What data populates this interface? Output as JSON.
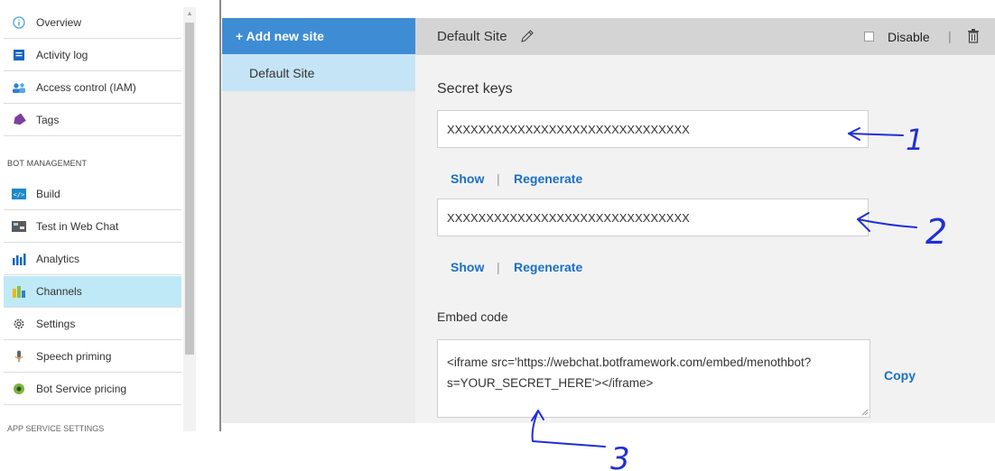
{
  "nav": {
    "items_top": [
      {
        "label": "Overview",
        "icon": "info-icon"
      },
      {
        "label": "Activity log",
        "icon": "log-icon"
      },
      {
        "label": "Access control (IAM)",
        "icon": "people-icon"
      },
      {
        "label": "Tags",
        "icon": "tag-icon"
      }
    ],
    "section_label": "BOT MANAGEMENT",
    "items_bot": [
      {
        "label": "Build",
        "icon": "code-icon"
      },
      {
        "label": "Test in Web Chat",
        "icon": "chat-icon"
      },
      {
        "label": "Analytics",
        "icon": "bar-chart-icon"
      },
      {
        "label": "Channels",
        "icon": "channels-icon",
        "active": true
      },
      {
        "label": "Settings",
        "icon": "gear-icon"
      },
      {
        "label": "Speech priming",
        "icon": "speech-icon"
      },
      {
        "label": "Bot Service pricing",
        "icon": "pricing-icon"
      }
    ],
    "cut_label": "APP SERVICE SETTINGS"
  },
  "sites": {
    "add_label": "+ Add new site",
    "items": [
      {
        "label": "Default Site",
        "selected": true
      }
    ]
  },
  "panel": {
    "site_name": "Default Site",
    "disable_label": "Disable",
    "separator": "|",
    "secret_keys_title": "Secret keys",
    "keys": [
      {
        "value": "XXXXXXXXXXXXXXXXXXXXXXXXXXXXXXX",
        "show": "Show",
        "regenerate": "Regenerate"
      },
      {
        "value": "XXXXXXXXXXXXXXXXXXXXXXXXXXXXXXX",
        "show": "Show",
        "regenerate": "Regenerate"
      }
    ],
    "embed_title": "Embed code",
    "embed_line1": "<iframe src='https://webchat.botframework.com/embed/menothbot?",
    "embed_line2": "s=YOUR_SECRET_HERE'></iframe>",
    "copy_label": "Copy"
  },
  "annotations": [
    "1",
    "2",
    "3"
  ],
  "colors": {
    "accent": "#3e8dd4",
    "selected": "#c5e4f6",
    "link": "#1b6fc3",
    "active_nav": "#bfe9f7",
    "annotation_ink": "#1f2fd6"
  }
}
